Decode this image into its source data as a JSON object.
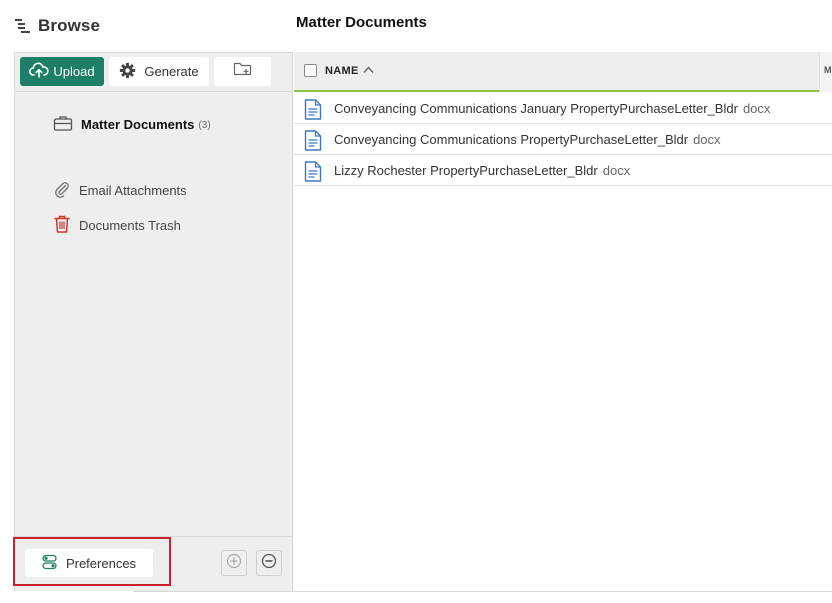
{
  "browse": {
    "title": "Browse",
    "icon": "tree-list-icon"
  },
  "main": {
    "title": "Matter Documents"
  },
  "toolbar": {
    "upload_label": "Upload",
    "generate_label": "Generate",
    "new_folder_icon": "new-folder-icon"
  },
  "tree": {
    "items": [
      {
        "label": "Matter Documents",
        "count": "(3)",
        "icon": "briefcase-icon",
        "selected": true
      },
      {
        "label": "Email Attachments",
        "icon": "paperclip-icon"
      },
      {
        "label": "Documents Trash",
        "icon": "trash-icon"
      }
    ]
  },
  "footer": {
    "preferences_label": "Preferences"
  },
  "grid": {
    "columns": [
      {
        "label": "NAME",
        "sort": "ascending"
      },
      {
        "label": "M"
      }
    ],
    "rows": [
      {
        "name": "Conveyancing Communications January PropertyPurchaseLetter_Bldr",
        "ext": "docx"
      },
      {
        "name": "Conveyancing Communications PropertyPurchaseLetter_Bldr",
        "ext": "docx"
      },
      {
        "name": "Lizzy Rochester PropertyPurchaseLetter_Bldr",
        "ext": "docx"
      }
    ]
  },
  "colors": {
    "accent": "#1e7f67",
    "header_underline": "#8bc34a",
    "highlight": "#cc1f2f",
    "trash": "#d0332f",
    "doc_icon": "#3a78c2"
  }
}
